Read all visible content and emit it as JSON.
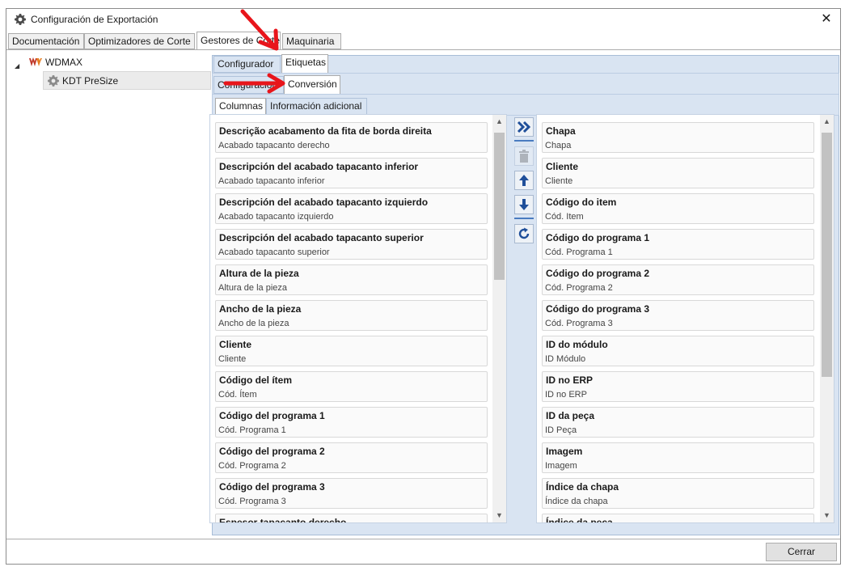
{
  "window": {
    "title": "Configuración de Exportación",
    "close_glyph": "✕"
  },
  "main_tabs": [
    {
      "label": "Documentación"
    },
    {
      "label": "Optimizadores de Corte"
    },
    {
      "label": "Gestores de Corte"
    },
    {
      "label": "Maquinaria"
    }
  ],
  "tree": {
    "root": "WDMAX",
    "child": "KDT PreSize"
  },
  "sub_tabs": [
    {
      "label": "Configurador"
    },
    {
      "label": "Etiquetas"
    }
  ],
  "sub_tabs2": [
    {
      "label": "Configuración"
    },
    {
      "label": "Conversión"
    }
  ],
  "sub_tabs3": [
    {
      "label": "Columnas"
    },
    {
      "label": "Información adicional"
    }
  ],
  "left_list": [
    {
      "label": "Descrição acabamento da fita de borda direita",
      "value": "Acabado tapacanto derecho"
    },
    {
      "label": "Descripción del acabado tapacanto inferior",
      "value": "Acabado tapacanto inferior"
    },
    {
      "label": "Descripción del acabado tapacanto izquierdo",
      "value": "Acabado tapacanto izquierdo"
    },
    {
      "label": "Descripción del acabado tapacanto superior",
      "value": "Acabado tapacanto superior"
    },
    {
      "label": "Altura de la pieza",
      "value": "Altura de la pieza"
    },
    {
      "label": "Ancho de la pieza",
      "value": "Ancho de la pieza"
    },
    {
      "label": "Cliente",
      "value": "Cliente"
    },
    {
      "label": "Código del ítem",
      "value": "Cód. Ítem"
    },
    {
      "label": "Código del programa 1",
      "value": "Cód. Programa 1"
    },
    {
      "label": "Código del programa 2",
      "value": "Cód. Programa 2"
    },
    {
      "label": "Código del programa 3",
      "value": "Cód. Programa 3"
    },
    {
      "label": "Espesor tapacanto derecho",
      "value": ""
    }
  ],
  "right_list": [
    {
      "label": "Chapa",
      "value": "Chapa"
    },
    {
      "label": "Cliente",
      "value": "Cliente"
    },
    {
      "label": "Código do item",
      "value": "Cód. Item"
    },
    {
      "label": "Código do programa 1",
      "value": "Cód. Programa 1"
    },
    {
      "label": "Código do programa 2",
      "value": "Cód. Programa 2"
    },
    {
      "label": "Código do programa 3",
      "value": "Cód. Programa 3"
    },
    {
      "label": "ID do módulo",
      "value": "ID Módulo"
    },
    {
      "label": "ID no ERP",
      "value": "ID no ERP"
    },
    {
      "label": "ID da peça",
      "value": "ID Peça"
    },
    {
      "label": "Imagem",
      "value": "Imagem"
    },
    {
      "label": "Índice da chapa",
      "value": "Índice da chapa"
    },
    {
      "label": "Índice da peça",
      "value": ""
    }
  ],
  "scroll": {
    "up": "▲",
    "down": "▼"
  },
  "tools": {
    "add_all": "add-all-icon",
    "delete": "trash-icon",
    "move_up": "arrow-up-icon",
    "move_down": "arrow-down-icon",
    "refresh": "refresh-icon"
  },
  "footer": {
    "close_label": "Cerrar"
  },
  "colors": {
    "panel_blue": "#d9e4f2",
    "accent_blue": "#2e63a8",
    "annotation_red": "#e8151b"
  }
}
